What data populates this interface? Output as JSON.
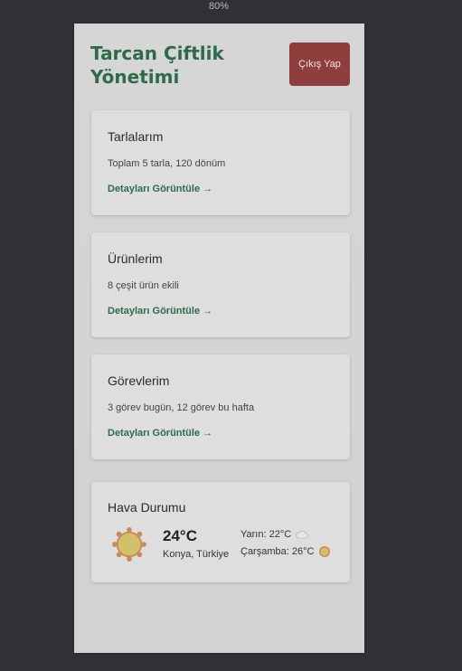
{
  "zoom": "80%",
  "header": {
    "title": "Tarcan Çiftlik Yönetimi",
    "logout_label": "Çıkış Yap"
  },
  "cards": [
    {
      "title": "Tarlalarım",
      "text": "Toplam 5 tarla, 120 dönüm",
      "link": "Detayları Görüntüle →"
    },
    {
      "title": "Ürünlerim",
      "text": "8 çeşit ürün ekili",
      "link": "Detayları Görüntüle →"
    },
    {
      "title": "Görevlerim",
      "text": "3 görev bugün, 12 görev bu hafta",
      "link": "Detayları Görüntüle →"
    }
  ],
  "weather": {
    "title": "Hava Durumu",
    "temperature": "24°C",
    "location": "Konya, Türkiye",
    "forecast": [
      {
        "label": "Yarın: 22°C",
        "icon": "cloud-icon"
      },
      {
        "label": "Çarşamba: 26°C",
        "icon": "sun-icon"
      }
    ]
  },
  "colors": {
    "brand_green": "#2f6b4a",
    "logout_red": "#8f3e3e",
    "background": "#2f3136",
    "sun": "#d4c06a"
  }
}
